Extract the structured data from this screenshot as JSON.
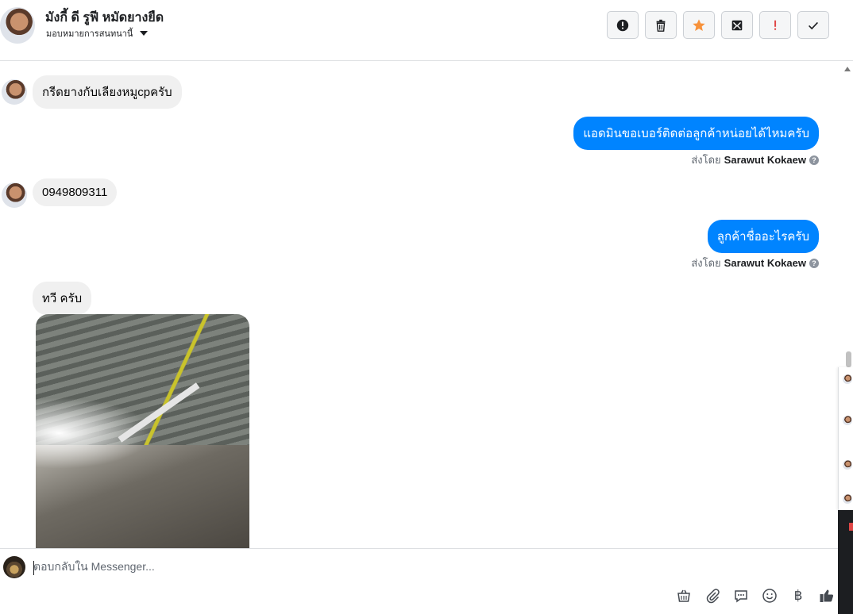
{
  "header": {
    "customer_name": "มังกี้ ดี รูฟี หมัดยางยืด",
    "assign_label": "มอบหมายการสนทนานี้",
    "actions": [
      {
        "name": "spam-button",
        "icon": "alert-circle-icon"
      },
      {
        "name": "delete-button",
        "icon": "trash-icon"
      },
      {
        "name": "star-button",
        "icon": "star-icon",
        "color": "#f7923b"
      },
      {
        "name": "mark-unread-button",
        "icon": "mail-open-icon"
      },
      {
        "name": "follow-up-button",
        "icon": "exclamation-icon",
        "color": "#e04646"
      },
      {
        "name": "mark-done-button",
        "icon": "check-icon"
      }
    ]
  },
  "messages": [
    {
      "direction": "in",
      "text": "กรีดยางกับเลียงหมูcpครับ"
    },
    {
      "direction": "out",
      "text": "แอดมินขอเบอร์ติดต่อลูกค้าหน่อยได้ไหมครับ",
      "sent_by_label": "ส่งโดย",
      "sender": "Sarawut Kokaew"
    },
    {
      "direction": "in",
      "text": "0949809311"
    },
    {
      "direction": "out",
      "text": "ลูกค้าชื่ออะไรครับ",
      "sent_by_label": "ส่งโดย",
      "sender": "Sarawut Kokaew"
    },
    {
      "direction": "in",
      "text": "ทวี ครับ"
    }
  ],
  "composer": {
    "placeholder": "ตอบกลับใน Messenger...",
    "tools": [
      "shopping-bag-icon",
      "paperclip-icon",
      "saved-replies-icon",
      "emoji-icon",
      "baht-icon",
      "thumbs-up-icon"
    ],
    "baht_symbol": "฿"
  },
  "colors": {
    "outgoing_bubble": "#0084ff",
    "incoming_bubble": "#f0f0f0",
    "thumbs_up": "#444950"
  }
}
